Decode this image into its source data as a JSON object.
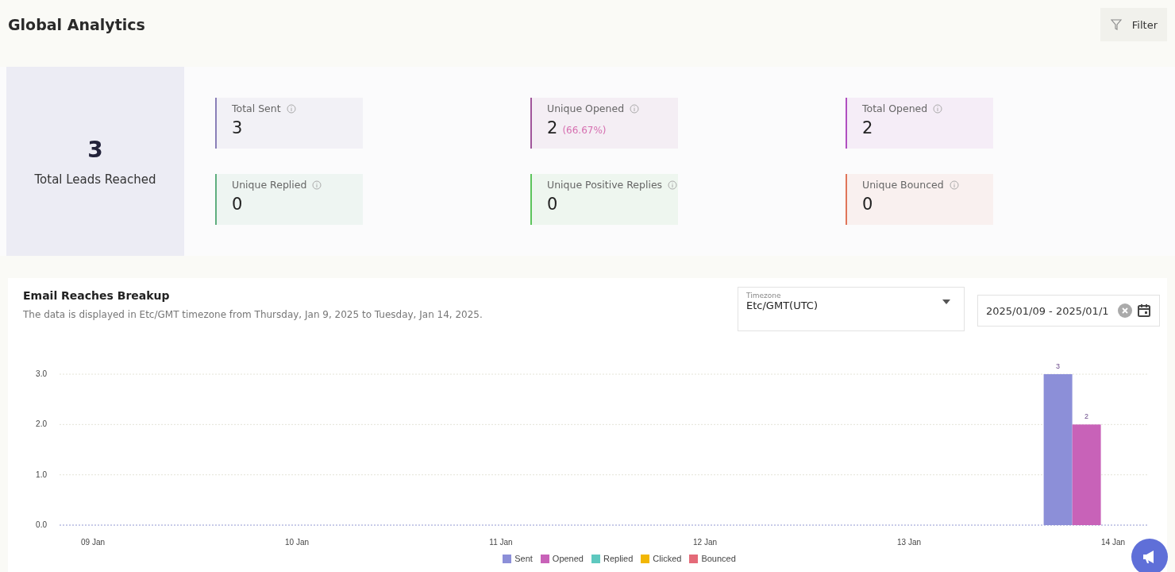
{
  "header": {
    "title": "Global Analytics",
    "filter_button": "Filter"
  },
  "total_leads": {
    "value": "3",
    "label": "Total Leads Reached"
  },
  "stats": [
    {
      "label": "Total Sent",
      "value": "3",
      "color": "#8a7fb8"
    },
    {
      "label": "Unique Opened",
      "value": "2",
      "percent": "(66.67%)",
      "color": "#a0559a"
    },
    {
      "label": "Total Opened",
      "value": "2",
      "color": "#b04fc0"
    },
    {
      "label": "Unique Replied",
      "value": "0",
      "color": "#5fae7f"
    },
    {
      "label": "Unique Positive Replies",
      "value": "0",
      "color": "#5cc45c"
    },
    {
      "label": "Unique Bounced",
      "value": "0",
      "color": "#e0755a"
    }
  ],
  "breakup": {
    "title": "Email Reaches Breakup",
    "subtitle": "The data is displayed in Etc/GMT timezone from Thursday, Jan 9, 2025 to Tuesday, Jan 14, 2025.",
    "timezone": {
      "label": "Timezone",
      "value": "Etc/GMT(UTC)"
    },
    "date_range": {
      "value": "2025/01/09 - 2025/01/1"
    },
    "chart_data": {
      "type": "bar",
      "categories": [
        "09 Jan",
        "10 Jan",
        "11 Jan",
        "12 Jan",
        "13 Jan",
        "14 Jan"
      ],
      "ylim": [
        0,
        3
      ],
      "yticks": [
        {
          "value": 0,
          "label": "0.0"
        },
        {
          "value": 1,
          "label": "1.0"
        },
        {
          "value": 2,
          "label": "2.0"
        },
        {
          "value": 3,
          "label": "3.0"
        }
      ],
      "data_labels": true,
      "series": [
        {
          "name": "Sent",
          "color": "#8c8fd8",
          "values": [
            null,
            null,
            null,
            null,
            null,
            3
          ]
        },
        {
          "name": "Opened",
          "color": "#c862b8",
          "values": [
            null,
            null,
            null,
            null,
            null,
            2
          ]
        },
        {
          "name": "Replied",
          "color": "#5ec8bf",
          "values": [
            null,
            null,
            null,
            null,
            null,
            null
          ]
        },
        {
          "name": "Clicked",
          "color": "#f2b705",
          "values": [
            null,
            null,
            null,
            null,
            null,
            null
          ]
        },
        {
          "name": "Bounced",
          "color": "#e46a78",
          "values": [
            null,
            null,
            null,
            null,
            null,
            null
          ]
        }
      ]
    }
  }
}
